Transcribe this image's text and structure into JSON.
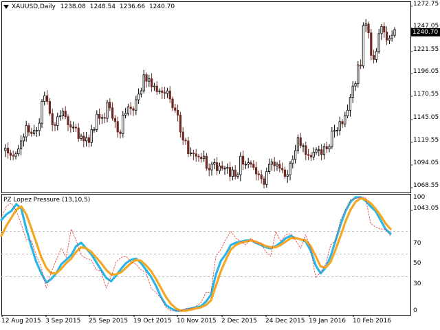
{
  "window": {
    "symbol_label": "XAUUSD,Daily",
    "ohlc": {
      "open": "1238.08",
      "high": "1248.54",
      "low": "1236.66",
      "close": "1240.70"
    },
    "current_price": "1240.70",
    "menu_icon": "triangle-down-icon"
  },
  "price_axis": {
    "ticks": [
      "1272.75",
      "1247.05",
      "1221.55",
      "1196.05",
      "1170.55",
      "1145.05",
      "1119.55",
      "1094.05",
      "1068.55",
      "1043.05"
    ]
  },
  "indicator": {
    "title": "PZ Lopez Pressure (13,10,5)",
    "axis_ticks": [
      "100",
      "70",
      "50",
      "30",
      "0"
    ],
    "levels": [
      70,
      50,
      30
    ]
  },
  "time_axis": {
    "ticks": [
      "12 Aug 2015",
      "3 Sep 2015",
      "25 Sep 2015",
      "19 Oct 2015",
      "10 Nov 2015",
      "2 Dec 2015",
      "24 Dec 2015",
      "19 Jan 2016",
      "10 Feb 2016"
    ]
  },
  "colors": {
    "bull": "#000000",
    "bear": "#6b2a23",
    "fast_line": "#29b6e8",
    "slow_line": "#f5a623",
    "signal_line": "#e53935",
    "level_line": "#c0c0c0",
    "price_tag_bg": "#000000"
  },
  "chart_data": [
    {
      "type": "candlestick",
      "title": "XAUUSD,Daily",
      "x_range": [
        "2015-08-03",
        "2016-02-29"
      ],
      "ylim": [
        1040,
        1277
      ],
      "x": [
        "Jul 30",
        "Jul 31",
        "Aug 3",
        "Aug 4",
        "Aug 5",
        "Aug 6",
        "Aug 7",
        "Aug 10",
        "Aug 11",
        "Aug 12",
        "Aug 13",
        "Aug 14",
        "Aug 17",
        "Aug 18",
        "Aug 19",
        "Aug 20",
        "Aug 21",
        "Aug 24",
        "Aug 25",
        "Aug 26",
        "Aug 27",
        "Aug 28",
        "Aug 31",
        "Sep 1",
        "Sep 2",
        "Sep 3",
        "Sep 4",
        "Sep 7",
        "Sep 8",
        "Sep 9",
        "Sep 10",
        "Sep 11",
        "Sep 14",
        "Sep 15",
        "Sep 16",
        "Sep 17",
        "Sep 18",
        "Sep 21",
        "Sep 22",
        "Sep 23",
        "Sep 24",
        "Sep 25",
        "Sep 28",
        "Sep 29",
        "Sep 30",
        "Oct 1",
        "Oct 2",
        "Oct 5",
        "Oct 6",
        "Oct 7",
        "Oct 8",
        "Oct 9",
        "Oct 12",
        "Oct 13",
        "Oct 14",
        "Oct 15",
        "Oct 16",
        "Oct 19",
        "Oct 20",
        "Oct 21",
        "Oct 22",
        "Oct 23",
        "Oct 26",
        "Oct 27",
        "Oct 28",
        "Oct 29",
        "Oct 30",
        "Nov 2",
        "Nov 3",
        "Nov 4",
        "Nov 5",
        "Nov 6",
        "Nov 9",
        "Nov 10",
        "Nov 11",
        "Nov 12",
        "Nov 13",
        "Nov 16",
        "Nov 17",
        "Nov 18",
        "Nov 19",
        "Nov 20",
        "Nov 23",
        "Nov 24",
        "Nov 25",
        "Nov 26",
        "Nov 27",
        "Nov 30",
        "Dec 1",
        "Dec 2",
        "Dec 3",
        "Dec 4",
        "Dec 7",
        "Dec 8",
        "Dec 9",
        "Dec 10",
        "Dec 11",
        "Dec 14",
        "Dec 15",
        "Dec 16",
        "Dec 17",
        "Dec 18",
        "Dec 21",
        "Dec 22",
        "Dec 23",
        "Dec 24",
        "Dec 28",
        "Dec 29",
        "Dec 30",
        "Dec 31",
        "Jan 4",
        "Jan 5",
        "Jan 6",
        "Jan 7",
        "Jan 8",
        "Jan 11",
        "Jan 12",
        "Jan 13",
        "Jan 14",
        "Jan 15",
        "Jan 18",
        "Jan 19",
        "Jan 20",
        "Jan 21",
        "Jan 22",
        "Jan 25",
        "Jan 26",
        "Jan 27",
        "Jan 28",
        "Jan 29",
        "Feb 1",
        "Feb 2",
        "Feb 3",
        "Feb 4",
        "Feb 5",
        "Feb 8",
        "Feb 9",
        "Feb 10",
        "Feb 11",
        "Feb 12",
        "Feb 15",
        "Feb 16",
        "Feb 17",
        "Feb 18",
        "Feb 19",
        "Feb 22",
        "Feb 23",
        "Feb 24",
        "Feb 25",
        "Feb 26",
        "Feb 29"
      ],
      "close": [
        1092,
        1095,
        1089,
        1086,
        1085,
        1088,
        1094,
        1104,
        1109,
        1123,
        1115,
        1113,
        1117,
        1117,
        1126,
        1153,
        1160,
        1153,
        1138,
        1124,
        1123,
        1134,
        1135,
        1141,
        1134,
        1124,
        1121,
        1121,
        1120,
        1107,
        1110,
        1104,
        1108,
        1102,
        1118,
        1118,
        1137,
        1132,
        1133,
        1132,
        1152,
        1145,
        1132,
        1128,
        1115,
        1113,
        1136,
        1138,
        1146,
        1144,
        1142,
        1155,
        1162,
        1166,
        1186,
        1178,
        1181,
        1171,
        1172,
        1165,
        1166,
        1164,
        1163,
        1166,
        1156,
        1145,
        1142,
        1136,
        1115,
        1105,
        1104,
        1088,
        1089,
        1088,
        1085,
        1084,
        1082,
        1085,
        1070,
        1068,
        1075,
        1077,
        1067,
        1073,
        1070,
        1070,
        1071,
        1060,
        1068,
        1060,
        1062,
        1085,
        1075,
        1075,
        1077,
        1075,
        1071,
        1063,
        1062,
        1057,
        1050,
        1066,
        1075,
        1078,
        1073,
        1075,
        1070,
        1068,
        1060,
        1062,
        1076,
        1081,
        1092,
        1108,
        1098,
        1098,
        1087,
        1086,
        1084,
        1090,
        1093,
        1093,
        1087,
        1097,
        1094,
        1097,
        1116,
        1117,
        1117,
        1128,
        1125,
        1135,
        1142,
        1158,
        1172,
        1175,
        1198,
        1197,
        1247,
        1249,
        1238,
        1210,
        1205,
        1215,
        1237,
        1246,
        1239,
        1229,
        1231,
        1235,
        1242
      ],
      "ylabel": ""
    },
    {
      "type": "line",
      "title": "PZ Lopez Pressure (13,10,5)",
      "ylim": [
        0,
        100
      ],
      "levels": [
        70,
        50,
        30
      ],
      "series": [
        {
          "values": [
            80,
            85,
            88,
            94,
            90,
            72,
            57,
            43,
            33,
            25,
            28,
            33,
            41,
            45,
            49,
            57,
            60,
            55,
            50,
            43,
            36,
            29,
            26,
            31,
            37,
            42,
            45,
            46,
            42,
            36,
            30,
            22,
            12,
            5,
            2,
            0,
            0,
            1,
            2,
            3,
            4,
            8,
            14,
            32,
            44,
            50,
            58,
            60,
            61,
            62,
            62,
            60,
            58,
            56,
            55,
            57,
            60,
            64,
            66,
            64,
            63,
            61,
            53,
            40,
            33,
            38,
            48,
            62,
            76,
            88,
            96,
            100,
            100,
            97,
            92,
            88,
            80,
            72,
            68
          ]
        },
        {
          "values": [
            66,
            75,
            82,
            89,
            92,
            85,
            73,
            60,
            47,
            38,
            33,
            33,
            37,
            42,
            46,
            52,
            56,
            55,
            52,
            47,
            42,
            36,
            32,
            32,
            34,
            38,
            42,
            45,
            44,
            40,
            35,
            28,
            20,
            12,
            6,
            2,
            0,
            0,
            1,
            2,
            3,
            5,
            9,
            22,
            35,
            45,
            54,
            58,
            60,
            61,
            62,
            61,
            59,
            57,
            56,
            56,
            58,
            61,
            64,
            64,
            63,
            62,
            57,
            48,
            39,
            38,
            43,
            54,
            66,
            79,
            89,
            96,
            99,
            98,
            95,
            90,
            84,
            77,
            72
          ]
        },
        {
          "values": [
            82,
            92,
            95,
            88,
            76,
            63,
            62,
            49,
            38,
            20,
            34,
            45,
            55,
            47,
            72,
            62,
            49,
            46,
            45,
            36,
            35,
            20,
            30,
            43,
            47,
            48,
            43,
            41,
            36,
            34,
            20,
            16,
            11,
            3,
            0,
            0,
            0,
            2,
            2,
            4,
            7,
            16,
            16,
            48,
            54,
            63,
            70,
            64,
            61,
            58,
            64,
            59,
            60,
            52,
            48,
            70,
            61,
            67,
            68,
            62,
            55,
            67,
            55,
            29,
            34,
            41,
            58,
            62,
            80,
            89,
            98,
            99,
            100,
            100,
            77,
            74,
            72,
            72,
            66
          ]
        }
      ]
    }
  ]
}
